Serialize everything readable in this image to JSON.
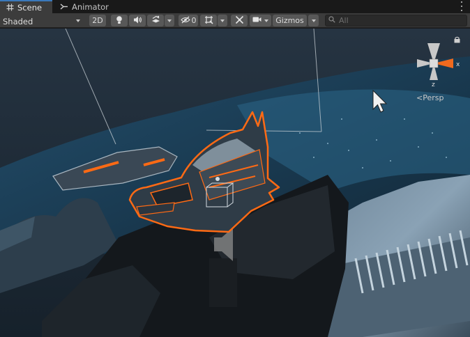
{
  "tabs": [
    {
      "label": "Scene",
      "icon": "grid-icon",
      "active": true
    },
    {
      "label": "Animator",
      "icon": "animator-icon",
      "active": false
    }
  ],
  "toolbar": {
    "draw_mode": "Shaded",
    "mode_2d": "2D",
    "hidden_count": "0",
    "gizmos": "Gizmos",
    "search_placeholder": "All"
  },
  "scene": {
    "projection_label": "Persp",
    "axis_x": "x",
    "axis_z": "z",
    "selection_color": "#ff6a14",
    "sky_color": "#1a2530",
    "water_color": "#1d4660"
  },
  "icons": [
    "grid-icon",
    "animator-icon",
    "kebab-menu-icon",
    "lighting-icon",
    "audio-icon",
    "effects-icon",
    "hidden-objects-icon",
    "grid-snap-icon",
    "tools-icon",
    "camera-icon",
    "search-icon",
    "lock-icon",
    "orientation-gizmo-icon",
    "mouse-cursor-icon",
    "audio-source-icon"
  ]
}
